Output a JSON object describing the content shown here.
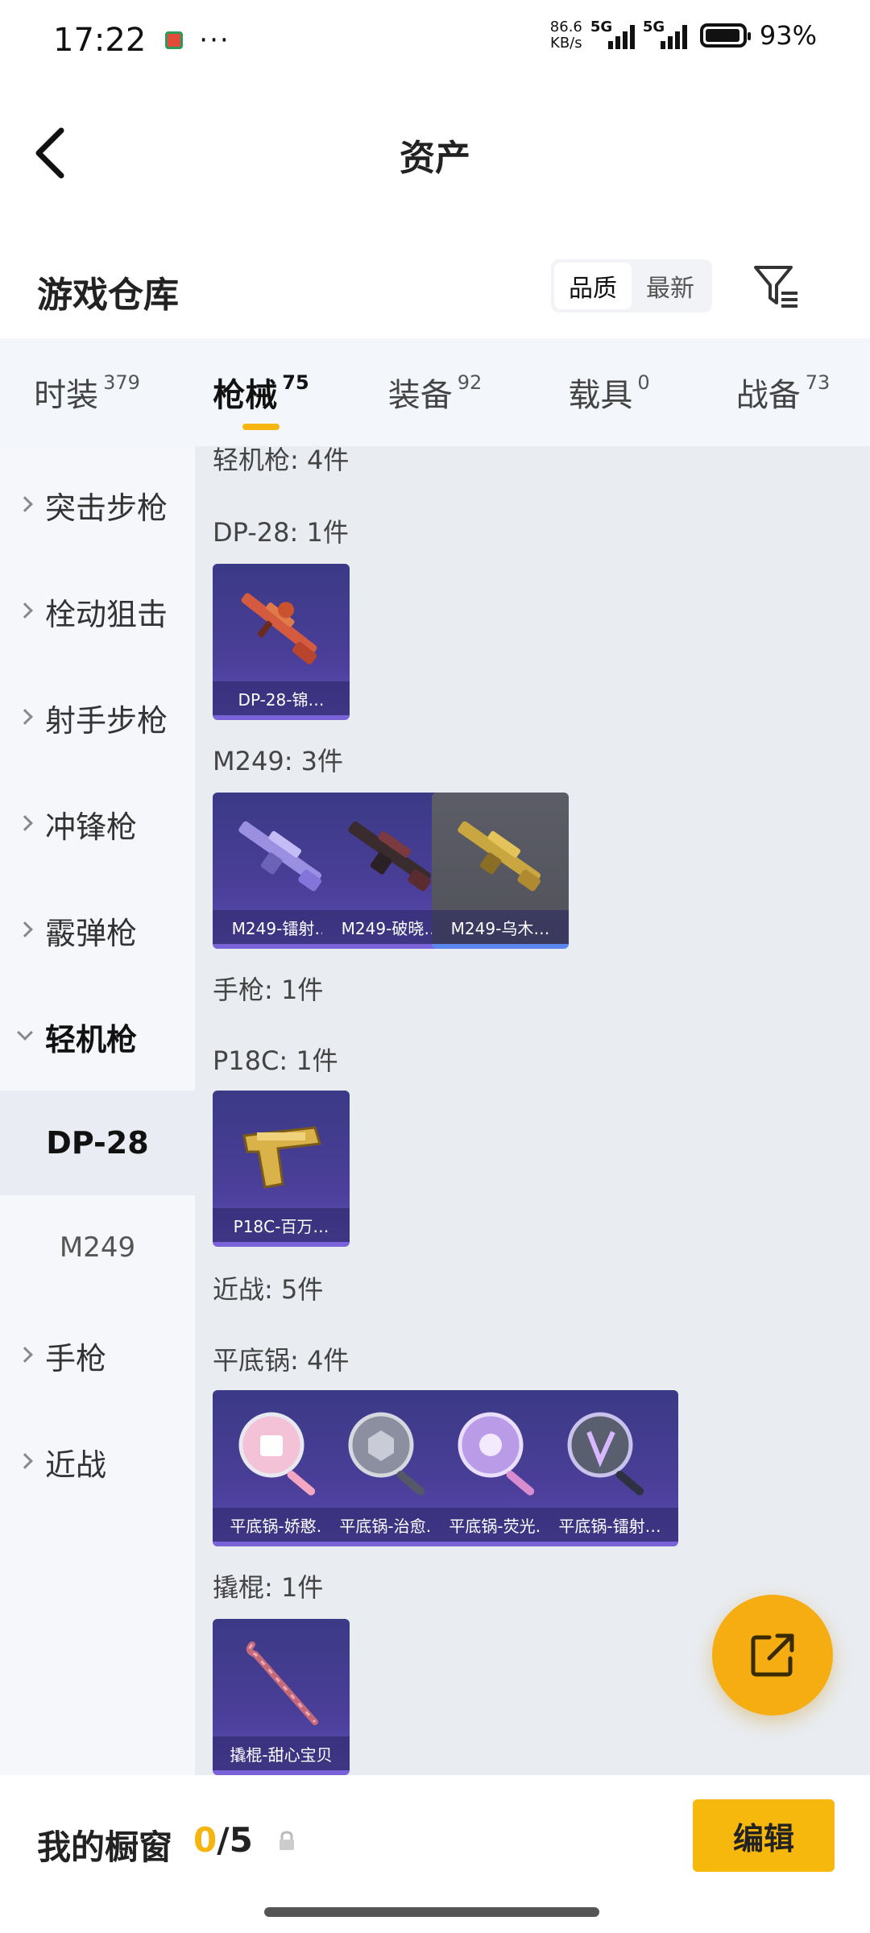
{
  "status": {
    "time": "17:22",
    "dots": "···",
    "netspeed_value": "86.6",
    "netspeed_unit": "KB/s",
    "sim1": "5G",
    "sim2": "5G",
    "battery": "93%"
  },
  "header": {
    "title": "资产"
  },
  "section": {
    "title": "游戏仓库",
    "sort": [
      {
        "label": "品质"
      },
      {
        "label": "最新"
      }
    ]
  },
  "tabs": [
    {
      "label": "时装",
      "count": "379"
    },
    {
      "label": "枪械",
      "count": "75"
    },
    {
      "label": "装备",
      "count": "92"
    },
    {
      "label": "载具",
      "count": "0"
    },
    {
      "label": "战备",
      "count": "73"
    }
  ],
  "sidebar": {
    "items": [
      {
        "label": "突击步枪"
      },
      {
        "label": "栓动狙击"
      },
      {
        "label": "射手步枪"
      },
      {
        "label": "冲锋枪"
      },
      {
        "label": "霰弹枪"
      },
      {
        "label": "轻机枪"
      },
      {
        "label": "手枪"
      },
      {
        "label": "近战"
      }
    ],
    "subitems": [
      {
        "label": "DP-28"
      },
      {
        "label": "M249"
      }
    ]
  },
  "content": {
    "groups": [
      {
        "label": "轻机枪: 4件"
      },
      {
        "label": "DP-28: 1件"
      },
      {
        "label": "M249: 3件"
      },
      {
        "label": "手枪: 1件"
      },
      {
        "label": "P18C: 1件"
      },
      {
        "label": "近战: 5件"
      },
      {
        "label": "平底锅: 4件"
      },
      {
        "label": "撬棍: 1件"
      }
    ],
    "items": [
      {
        "name": "DP-28-锦…"
      },
      {
        "name": "M249-镭射…"
      },
      {
        "name": "M249-破晓…"
      },
      {
        "name": "M249-乌木…"
      },
      {
        "name": "P18C-百万…"
      },
      {
        "name": "平底锅-娇憨…"
      },
      {
        "name": "平底锅-治愈…"
      },
      {
        "name": "平底锅-荧光…"
      },
      {
        "name": "平底锅-镭射…"
      },
      {
        "name": "撬棍-甜心宝贝"
      }
    ]
  },
  "bottom": {
    "label": "我的橱窗",
    "current": "0",
    "sep_total": "/5",
    "edit": "编辑"
  },
  "colors": {
    "accent": "#f6b80c",
    "card_purple": "#4a3e98",
    "card_gray": "#55565f",
    "content_bg": "#e9ecf1"
  }
}
